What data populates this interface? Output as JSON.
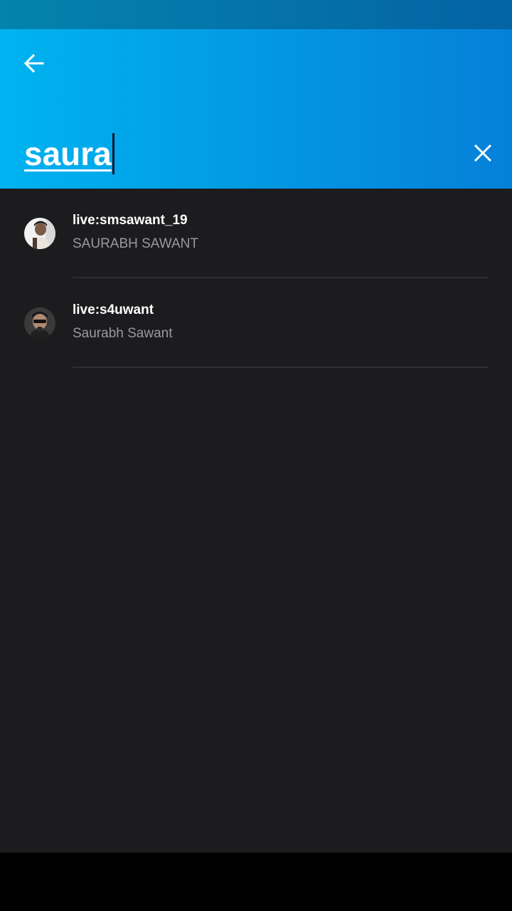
{
  "search": {
    "query": "saura"
  },
  "results": [
    {
      "username": "live:smsawant_19",
      "display_name": "SAURABH SAWANT"
    },
    {
      "username": "live:s4uwant",
      "display_name": "Saurabh Sawant"
    }
  ],
  "colors": {
    "app_bar_gradient_start": "#00b3f0",
    "app_bar_gradient_end": "#0580d8",
    "content_background": "#1c1c1e",
    "primary_text": "#ffffff",
    "secondary_text": "#9a9a9e",
    "divider": "#2e2e31"
  },
  "icons": {
    "back": "arrow-left-icon",
    "clear": "close-icon"
  }
}
